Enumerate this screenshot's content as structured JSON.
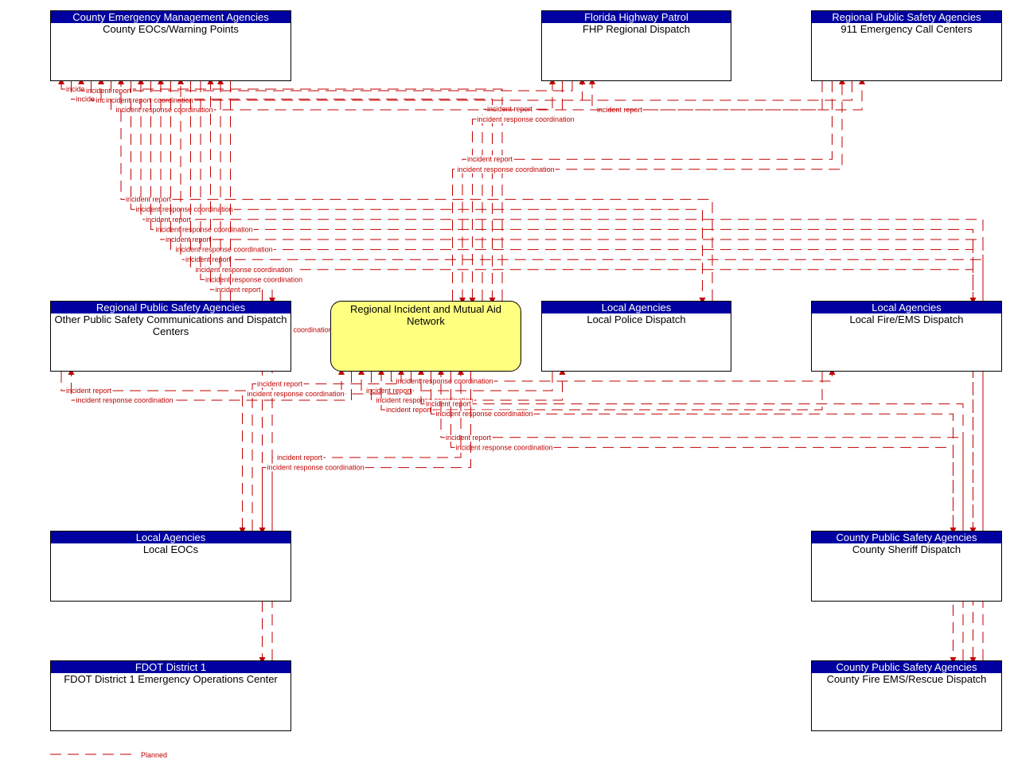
{
  "diagram": {
    "flow_color": "#c00000",
    "header_color": "#0000a0",
    "hub_color": "#ffff80",
    "nodes": {
      "county_eoc": {
        "agency": "County Emergency Management Agencies",
        "name": "County EOCs/Warning Points"
      },
      "fhp": {
        "agency": "Florida Highway Patrol",
        "name": "FHP Regional Dispatch"
      },
      "call911": {
        "agency": "Regional Public Safety Agencies",
        "name": "911 Emergency Call Centers"
      },
      "other_psap": {
        "agency": "Regional Public Safety Agencies",
        "name": "Other Public Safety Communications and Dispatch Centers"
      },
      "hub": {
        "name": "Regional Incident and Mutual Aid Network"
      },
      "police": {
        "agency": "Local Agencies",
        "name": "Local Police Dispatch"
      },
      "fire": {
        "agency": "Local Agencies",
        "name": "Local Fire/EMS Dispatch"
      },
      "local_eoc": {
        "agency": "Local Agencies",
        "name": "Local EOCs"
      },
      "sheriff": {
        "agency": "County Public Safety Agencies",
        "name": "County Sheriff Dispatch"
      },
      "fdot": {
        "agency": "FDOT District 1",
        "name": "FDOT District 1 Emergency Operations Center"
      },
      "county_fire": {
        "agency": "County Public Safety Agencies",
        "name": "County Fire EMS/Rescue Dispatch"
      }
    },
    "flows": [
      {
        "from": "hub",
        "to": "county_eoc",
        "label": "incident report"
      },
      {
        "from": "county_eoc",
        "to": "hub",
        "label": "incident response coordination"
      },
      {
        "from": "hub",
        "to": "fhp",
        "label": "incident report"
      },
      {
        "from": "fhp",
        "to": "hub",
        "label": "incident response coordination"
      },
      {
        "from": "fhp",
        "to": "county_eoc",
        "label": "incident report"
      },
      {
        "from": "county_eoc",
        "to": "fhp",
        "label": "incident response coordination"
      },
      {
        "from": "call911",
        "to": "fhp",
        "label": "incident report"
      },
      {
        "from": "call911",
        "to": "hub",
        "label": "incident report"
      },
      {
        "from": "hub",
        "to": "call911",
        "label": "incident response coordination"
      },
      {
        "from": "call911",
        "to": "county_eoc",
        "label": "incident report"
      },
      {
        "from": "county_eoc",
        "to": "call911",
        "label": "incident response coordination"
      },
      {
        "from": "police",
        "to": "county_eoc",
        "label": "incident report"
      },
      {
        "from": "county_eoc",
        "to": "police",
        "label": "incident response coordination"
      },
      {
        "from": "fire",
        "to": "county_eoc",
        "label": "incident report"
      },
      {
        "from": "county_eoc",
        "to": "fire",
        "label": "incident response coordination"
      },
      {
        "from": "sheriff",
        "to": "county_eoc",
        "label": "incident report"
      },
      {
        "from": "county_eoc",
        "to": "sheriff",
        "label": "incident response coordination"
      },
      {
        "from": "county_fire",
        "to": "county_eoc",
        "label": "incident report"
      },
      {
        "from": "county_eoc",
        "to": "county_fire",
        "label": "incident response coordination"
      },
      {
        "from": "county_eoc",
        "to": "other_psap",
        "label": "incident response coordination"
      },
      {
        "from": "other_psap",
        "to": "county_eoc",
        "label": "incident report"
      },
      {
        "from": "other_psap",
        "to": "hub",
        "label": "incident report"
      },
      {
        "from": "hub",
        "to": "other_psap",
        "label": "incident response coordination"
      },
      {
        "from": "local_eoc",
        "to": "county_eoc",
        "label": "incident report"
      },
      {
        "from": "county_eoc",
        "to": "local_eoc",
        "label": "incident response coordination"
      },
      {
        "from": "police",
        "to": "hub",
        "label": "incident report"
      },
      {
        "from": "hub",
        "to": "police",
        "label": "incident response coordination"
      },
      {
        "from": "fire",
        "to": "hub",
        "label": "incident report"
      },
      {
        "from": "hub",
        "to": "fire",
        "label": "incident response coordination"
      },
      {
        "from": "local_eoc",
        "to": "hub",
        "label": "incident report"
      },
      {
        "from": "hub",
        "to": "local_eoc",
        "label": "incident response coordination"
      },
      {
        "from": "sheriff",
        "to": "hub",
        "label": "incident report"
      },
      {
        "from": "hub",
        "to": "sheriff",
        "label": "incident response coordination"
      },
      {
        "from": "county_fire",
        "to": "hub",
        "label": "incident report"
      },
      {
        "from": "hub",
        "to": "county_fire",
        "label": "incident response coordination"
      },
      {
        "from": "fdot",
        "to": "hub",
        "label": "incident report"
      },
      {
        "from": "hub",
        "to": "fdot",
        "label": "incident response coordination"
      }
    ],
    "legend": {
      "label": "Planned"
    }
  }
}
